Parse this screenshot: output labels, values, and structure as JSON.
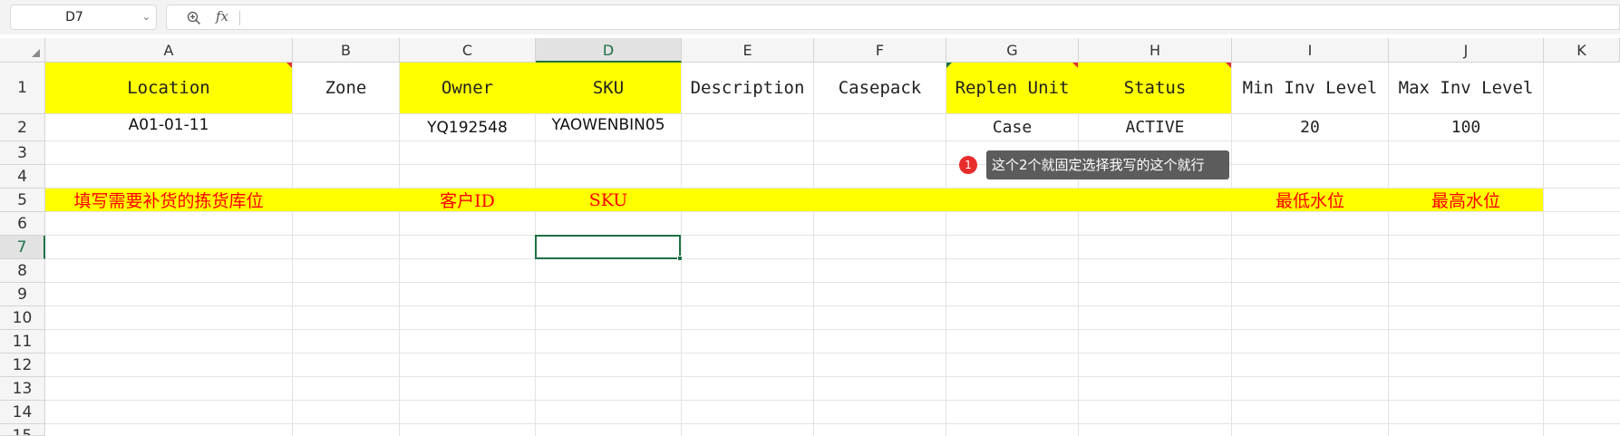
{
  "formula_bar": {
    "name_box": "D7",
    "name_box_chevron": "chevron-down-icon",
    "zoom_icon": "zoom-icon",
    "fx_label": "fx",
    "formula": ""
  },
  "columns": [
    "A",
    "B",
    "C",
    "D",
    "E",
    "F",
    "G",
    "H",
    "I",
    "J",
    "K"
  ],
  "selected_column": "D",
  "rows": [
    "1",
    "2",
    "3",
    "4",
    "5",
    "6",
    "7",
    "8",
    "9",
    "10",
    "11",
    "12",
    "13",
    "14",
    "15"
  ],
  "selected_row": "7",
  "cells": {
    "A1": "Location",
    "B1": "Zone",
    "C1": "Owner",
    "D1": "SKU",
    "E1": "Description",
    "F1": "Casepack",
    "G1": "Replen Unit",
    "H1": "Status",
    "I1": "Min Inv Level",
    "J1": "Max Inv Level",
    "A2": "A01-01-11",
    "C2": "YQ192548",
    "D2": "YAOWENBIN05",
    "G2": "Case",
    "H2": "ACTIVE",
    "I2": "20",
    "J2": "100",
    "A5": "填写需要补货的拣货库位",
    "C5": "客户ID",
    "D5": "SKU",
    "I5": "最低水位",
    "J5": "最高水位"
  },
  "comment": {
    "badge": "1",
    "text": "这个2个就固定选择我写的这个就行"
  },
  "colors": {
    "fill_yellow": "#ffff00",
    "note_red": "#ff0000",
    "selection_green": "#1e7145"
  }
}
